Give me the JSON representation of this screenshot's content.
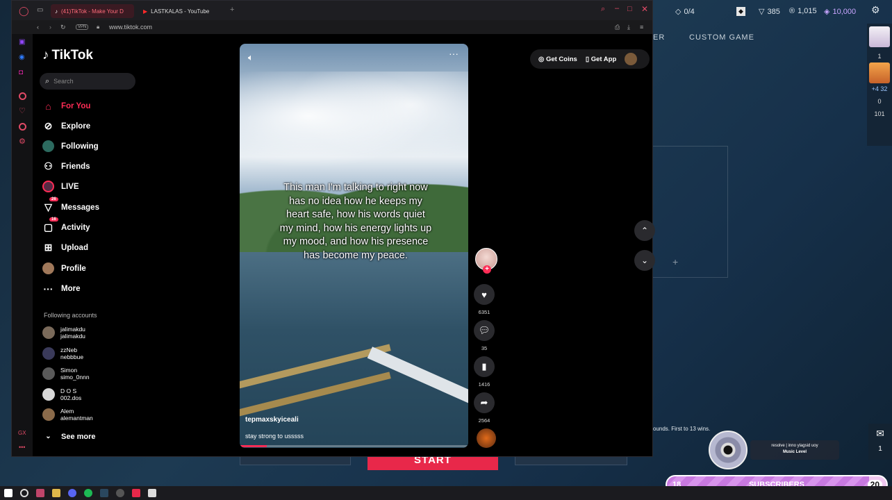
{
  "game": {
    "agents": "0/4",
    "currency_a": "385",
    "currency_b": "1,015",
    "currency_c": "10,000",
    "tab_partial": "ER",
    "tab_custom": "CUSTOM GAME",
    "rounds_text": "ounds. First to 13 wins.",
    "right_panel": [
      "1",
      "+4 32",
      "0",
      "101"
    ],
    "mail_count": "1",
    "start_label": "START",
    "music_title": "Music Level",
    "music_sub": "resolve | inno ylagsid uoy",
    "subs": {
      "start": "18",
      "label": "SUBSCRIBERS",
      "end": "20",
      "progress": 0.92
    },
    "colors": {
      "accent": "#e8284a",
      "subs": "#c879e0"
    }
  },
  "browser": {
    "tabs": [
      {
        "label": "(41)TikTok - Make Your D",
        "icon": "tiktok-icon"
      },
      {
        "label": "LASTKALAS - YouTube",
        "icon": "youtube-icon"
      }
    ],
    "vpn": "VPN",
    "url": "www.tiktok.com"
  },
  "tiktok": {
    "logo": "TikTok",
    "search_placeholder": "Search",
    "nav": [
      {
        "label": "For You",
        "icon": "home-icon",
        "active": true
      },
      {
        "label": "Explore",
        "icon": "compass-icon"
      },
      {
        "label": "Following",
        "icon": "following-icon"
      },
      {
        "label": "Friends",
        "icon": "friends-icon"
      },
      {
        "label": "LIVE",
        "icon": "live-icon"
      },
      {
        "label": "Messages",
        "icon": "messages-icon",
        "badge": "26"
      },
      {
        "label": "Activity",
        "icon": "activity-icon",
        "badge": "16"
      },
      {
        "label": "Upload",
        "icon": "upload-icon"
      },
      {
        "label": "Profile",
        "icon": "profile-icon"
      },
      {
        "label": "More",
        "icon": "more-icon"
      }
    ],
    "following_title": "Following accounts",
    "following": [
      {
        "name": "jalimakdu",
        "handle": "jalimakdu"
      },
      {
        "name": "zzNeb",
        "handle": "nebbbue"
      },
      {
        "name": "Simon",
        "handle": "simo_0nnn"
      },
      {
        "name": "D O S",
        "handle": "002.dos"
      },
      {
        "name": "Alem",
        "handle": "alemantman"
      }
    ],
    "see_more": "See more",
    "top_right": {
      "coins": "Get Coins",
      "app": "Get App"
    },
    "video": {
      "caption": "This man I'm talking to right now has no idea how he keeps my heart safe, how his words quiet my mind, how his energy lights up my mood, and how his presence has become my peace.",
      "username": "tepmaxskyiceali",
      "description": "stay strong to usssss",
      "progress": 0.12
    },
    "actions": {
      "likes": "6351",
      "comments": "35",
      "saves": "1416",
      "shares": "2564"
    }
  }
}
